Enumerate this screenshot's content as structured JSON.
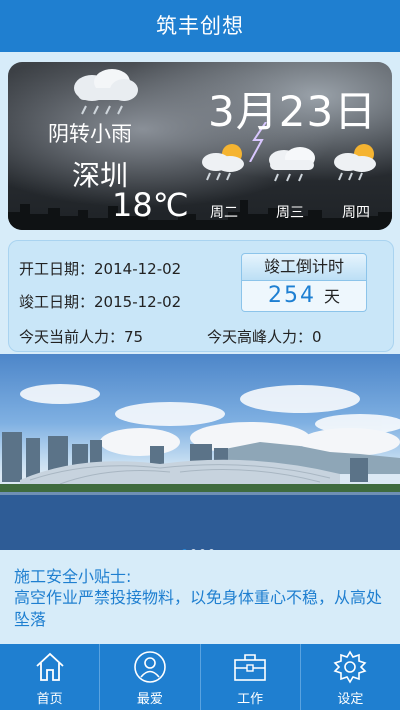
{
  "app": {
    "title": "筑丰创想"
  },
  "weather": {
    "description": "阴转小雨",
    "city": "深圳",
    "temperature": "18℃",
    "date": "3月23日",
    "forecast": [
      {
        "day": "周二",
        "icon": "cloud-sun-rain-icon"
      },
      {
        "day": "周三",
        "icon": "cloud-rain-icon"
      },
      {
        "day": "周四",
        "icon": "cloud-sun-rain-icon"
      }
    ]
  },
  "project": {
    "start_label": "开工日期：",
    "start_date": "2014-12-02",
    "end_label": "竣工日期：",
    "end_date": "2015-12-02",
    "current_label": "今天当前人力：",
    "current_value": "75",
    "peak_label": "今天高峰人力：",
    "peak_value": "0",
    "countdown_title": "竣工倒计时",
    "countdown_days": "254",
    "countdown_unit": "天"
  },
  "carousel": {
    "slides": 4,
    "active": 0
  },
  "tips": {
    "title": "施工安全小贴士:",
    "text": "高空作业严禁投接物料，以免身体重心不稳，从高处坠落"
  },
  "tabs": [
    {
      "label": "首页",
      "icon": "home-icon"
    },
    {
      "label": "最爱",
      "icon": "user-icon"
    },
    {
      "label": "工作",
      "icon": "briefcase-icon"
    },
    {
      "label": "设定",
      "icon": "gear-icon"
    }
  ],
  "colors": {
    "primary": "#1f7fd0",
    "accent_text": "#1d7fd2",
    "panel_bg": "#c9e6f8"
  }
}
